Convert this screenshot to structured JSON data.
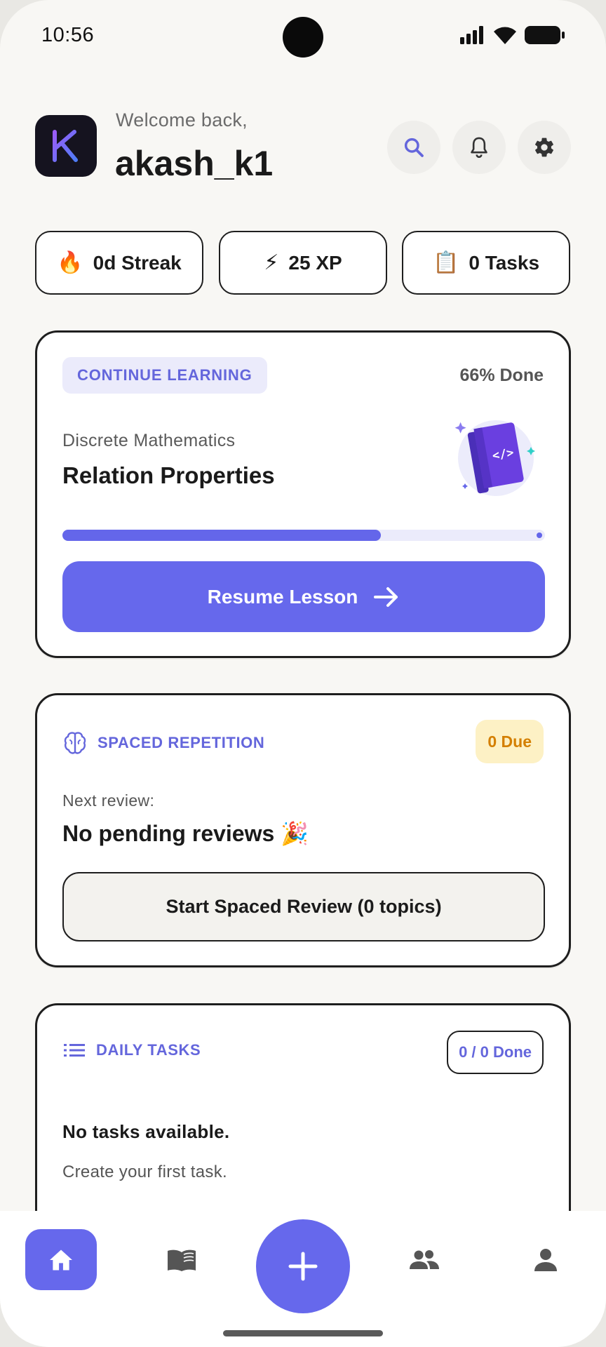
{
  "status_bar": {
    "time": "10:56"
  },
  "header": {
    "logo_letter": "K",
    "welcome": "Welcome back,",
    "username": "akash_k1"
  },
  "stats": [
    {
      "emoji": "🔥",
      "label": "0d Streak"
    },
    {
      "emoji": "⚡",
      "label": "25 XP"
    },
    {
      "emoji": "📋",
      "label": "0 Tasks"
    }
  ],
  "continue_card": {
    "badge": "CONTINUE LEARNING",
    "done": "66% Done",
    "progress": 0.66,
    "subject": "Discrete Mathematics",
    "title": "Relation Properties",
    "button": "Resume Lesson",
    "book_code": "</>"
  },
  "spaced_card": {
    "title": "SPACED REPETITION",
    "due": "0 Due",
    "next_label": "Next review:",
    "next_value": "No pending reviews 🎉",
    "button": "Start Spaced Review (0 topics)"
  },
  "tasks_card": {
    "title": "DAILY TASKS",
    "done": "0 / 0 Done",
    "empty_title": "No tasks available.",
    "empty_sub": "Create your first task."
  },
  "bottom_nav": {
    "items": [
      "home-icon",
      "book-icon",
      "add-icon",
      "people-icon",
      "person-icon"
    ],
    "accent": "#6668ec"
  }
}
